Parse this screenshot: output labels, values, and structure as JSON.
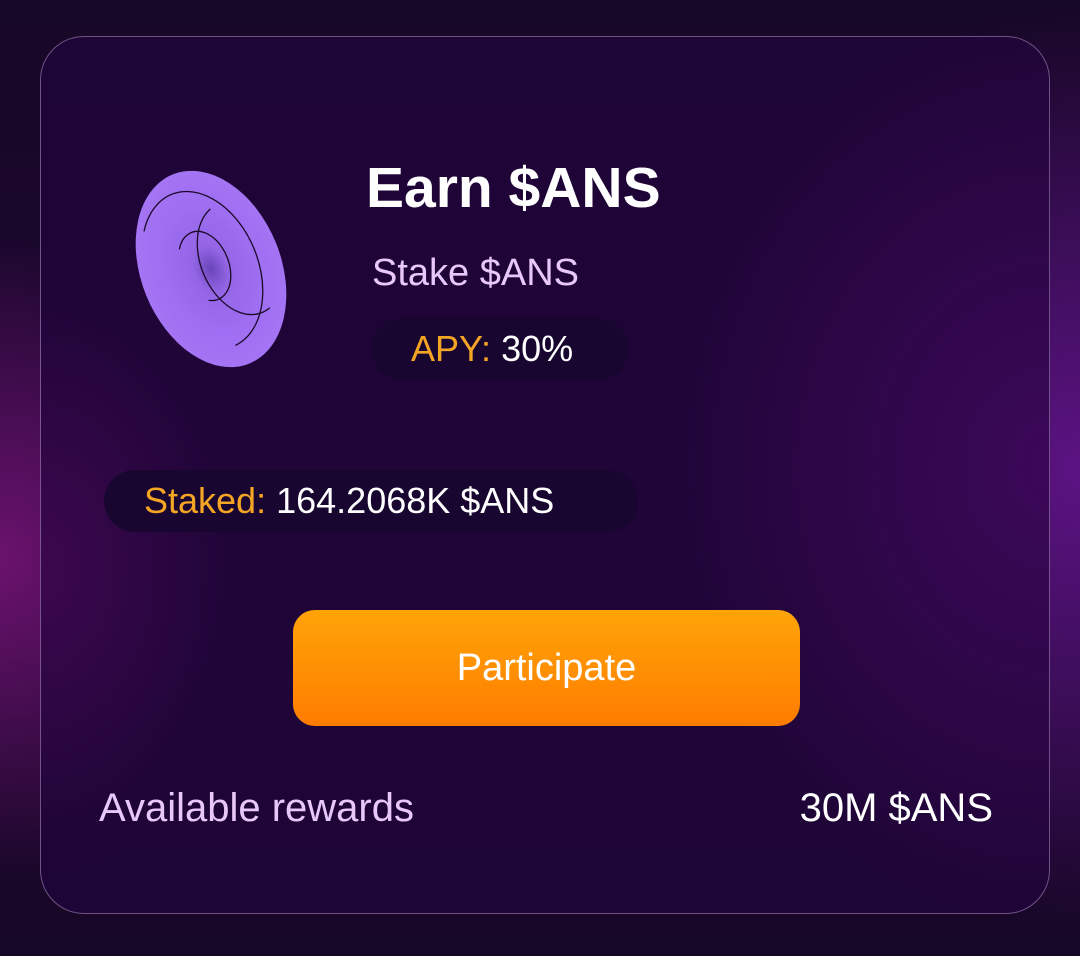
{
  "card": {
    "title": "Earn $ANS",
    "subtitle": "Stake $ANS",
    "logo_icon": "ans-token-logo-icon",
    "apy": {
      "label": "APY:",
      "value": "30%"
    },
    "staked": {
      "label": "Staked:",
      "value": "164.2068K $ANS"
    },
    "cta_label": "Participate",
    "rewards": {
      "label": "Available rewards",
      "value": "30M $ANS"
    }
  },
  "colors": {
    "accent_orange": "#ff8c00",
    "label_orange": "#f5a524",
    "logo_purple": "#9d6cf0",
    "card_background": "#1f0538",
    "lilac_text": "#e8c8f8"
  }
}
